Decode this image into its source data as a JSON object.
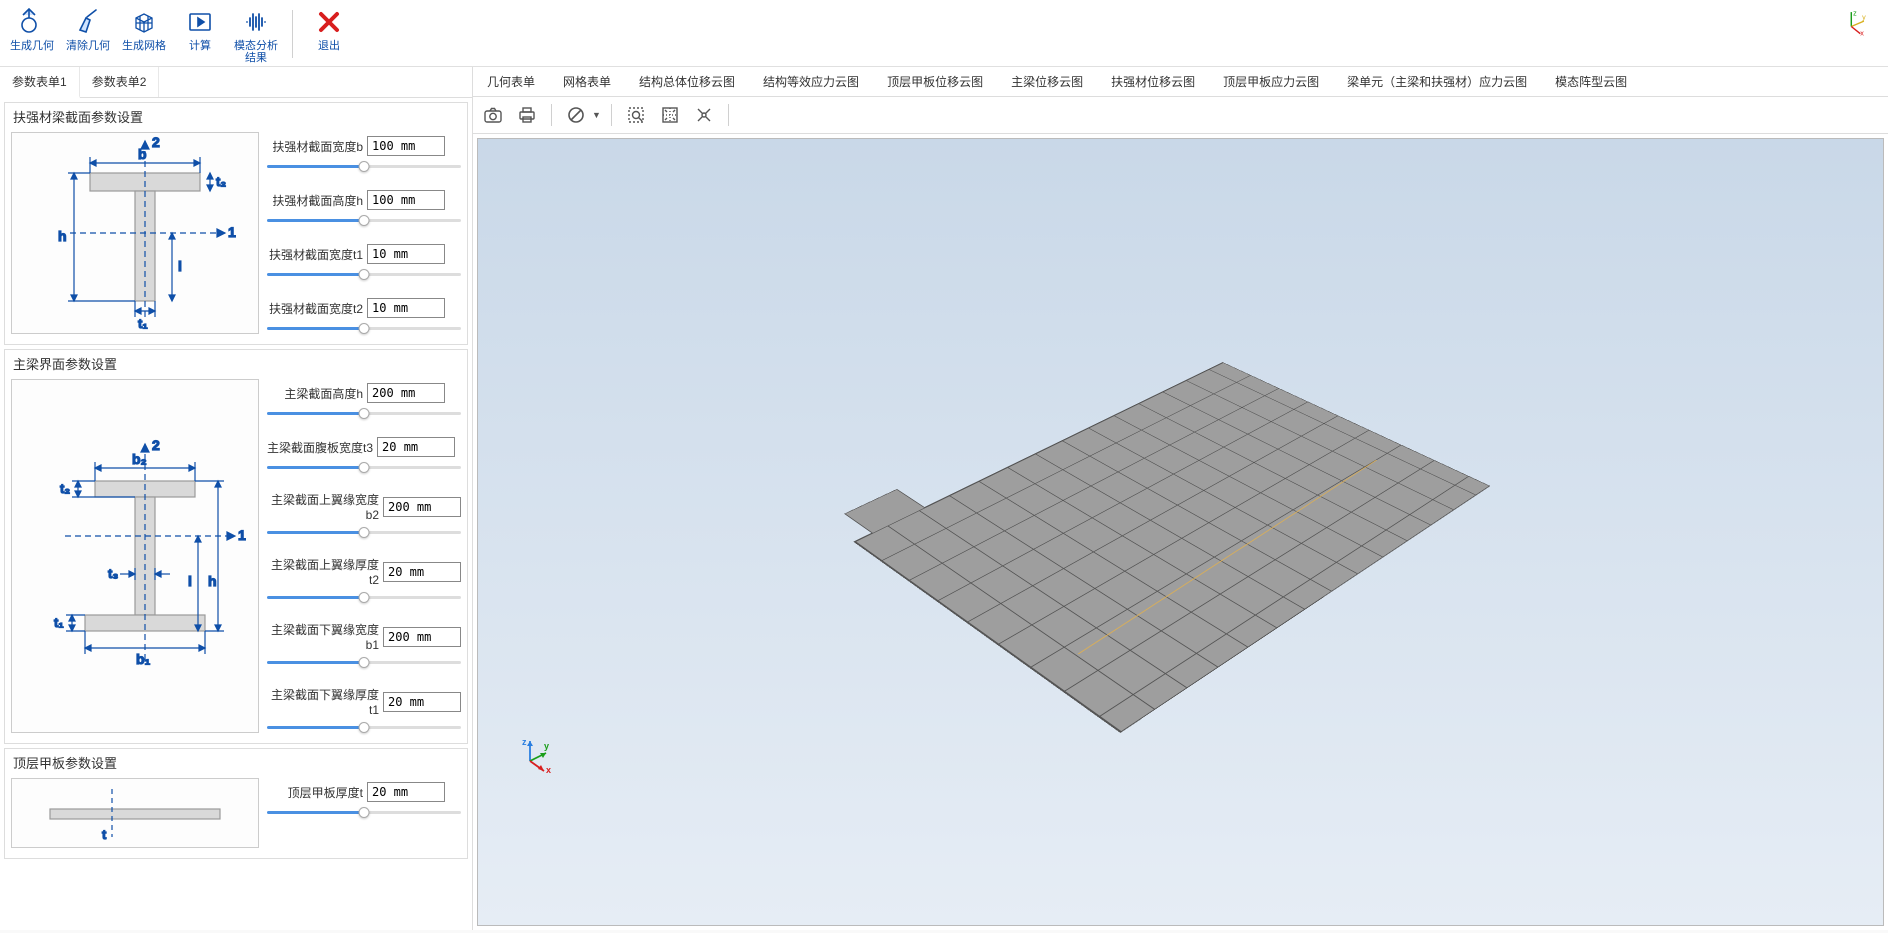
{
  "toolbar": {
    "items": [
      {
        "id": "gen-geo",
        "label": "生成几何"
      },
      {
        "id": "clear-geo",
        "label": "清除几何"
      },
      {
        "id": "gen-mesh",
        "label": "生成网格"
      },
      {
        "id": "compute",
        "label": "计算"
      },
      {
        "id": "modal",
        "label": "模态分析结果"
      },
      {
        "id": "exit",
        "label": "退出"
      }
    ]
  },
  "left": {
    "tabs": [
      "参数表单1",
      "参数表单2"
    ],
    "active_tab": 0,
    "groups": [
      {
        "title": "扶强材梁截面参数设置",
        "diagram": "t-section",
        "params": [
          {
            "label": "扶强材截面宽度b",
            "value": "100 mm"
          },
          {
            "label": "扶强材截面高度h",
            "value": "100 mm"
          },
          {
            "label": "扶强材截面宽度t1",
            "value": "10 mm"
          },
          {
            "label": "扶强材截面宽度t2",
            "value": "10 mm"
          }
        ]
      },
      {
        "title": "主梁界面参数设置",
        "diagram": "i-section",
        "params": [
          {
            "label": "主梁截面高度h",
            "value": "200 mm"
          },
          {
            "label": "主梁截面腹板宽度t3",
            "value": "20 mm"
          },
          {
            "label": "主梁截面上翼缘宽度b2",
            "value": "200 mm"
          },
          {
            "label": "主梁截面上翼缘厚度t2",
            "value": "20 mm"
          },
          {
            "label": "主梁截面下翼缘宽度b1",
            "value": "200 mm"
          },
          {
            "label": "主梁截面下翼缘厚度t1",
            "value": "20 mm"
          }
        ]
      },
      {
        "title": "顶层甲板参数设置",
        "diagram": "plate-section",
        "params": [
          {
            "label": "顶层甲板厚度t",
            "value": "20 mm"
          }
        ]
      }
    ]
  },
  "right": {
    "tabs": [
      "几何表单",
      "网格表单",
      "结构总体位移云图",
      "结构等效应力云图",
      "顶层甲板位移云图",
      "主梁位移云图",
      "扶强材位移云图",
      "顶层甲板应力云图",
      "梁单元（主梁和扶强材）应力云图",
      "模态阵型云图"
    ],
    "active_tab": 0,
    "view_tools": [
      "camera",
      "print",
      "cancel",
      "dd",
      "zoom-box",
      "fit",
      "pick",
      "axes"
    ]
  },
  "colors": {
    "accent": "#0f4fa8",
    "danger": "#d81e1e"
  }
}
